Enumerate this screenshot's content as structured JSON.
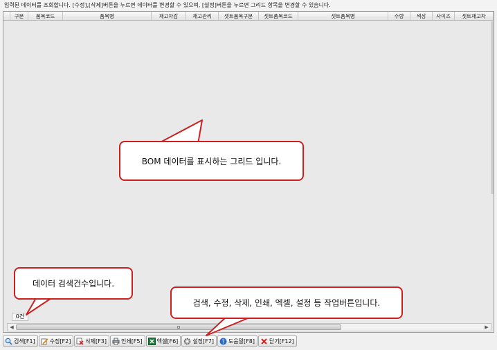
{
  "info_text": "입력된 데이터를 조회합니다. [수정],[삭제]버튼을 누르면 데이터를 변경할 수 있으며, [설정]버튼을 누르면 그리드 항목을 변경할 수 있습니다.",
  "grid": {
    "columns": [
      "구분",
      "품목코드",
      "품목명",
      "재고차감",
      "재고관리",
      "셋트품목구분",
      "셋트품목코드",
      "셋트품목명",
      "수량",
      "색상",
      "사이즈",
      "셋트재고차"
    ],
    "record_count": "0건"
  },
  "toolbar": [
    {
      "label": "검색[F1]",
      "icon": "search-icon"
    },
    {
      "label": "수정[F2]",
      "icon": "edit-icon"
    },
    {
      "label": "삭제[F3]",
      "icon": "delete-icon"
    },
    {
      "label": "인쇄[F5]",
      "icon": "print-icon"
    },
    {
      "label": "엑셀[F6]",
      "icon": "excel-icon"
    },
    {
      "label": "설정[F7]",
      "icon": "gear-icon"
    },
    {
      "label": "도움말[F8]",
      "icon": "help-icon"
    },
    {
      "label": "닫기[F12]",
      "icon": "close-icon"
    }
  ],
  "callouts": {
    "grid": "BOM 데이터를 표시하는 그리드 입니다.",
    "count": "데이터 검색건수입니다.",
    "buttons": "검색, 수정, 삭제, 인쇄, 엑셀, 설정 등 작업버튼입니다."
  },
  "colors": {
    "callout_border": "#cc1f1f",
    "grid_background": "#e9e9e9"
  }
}
